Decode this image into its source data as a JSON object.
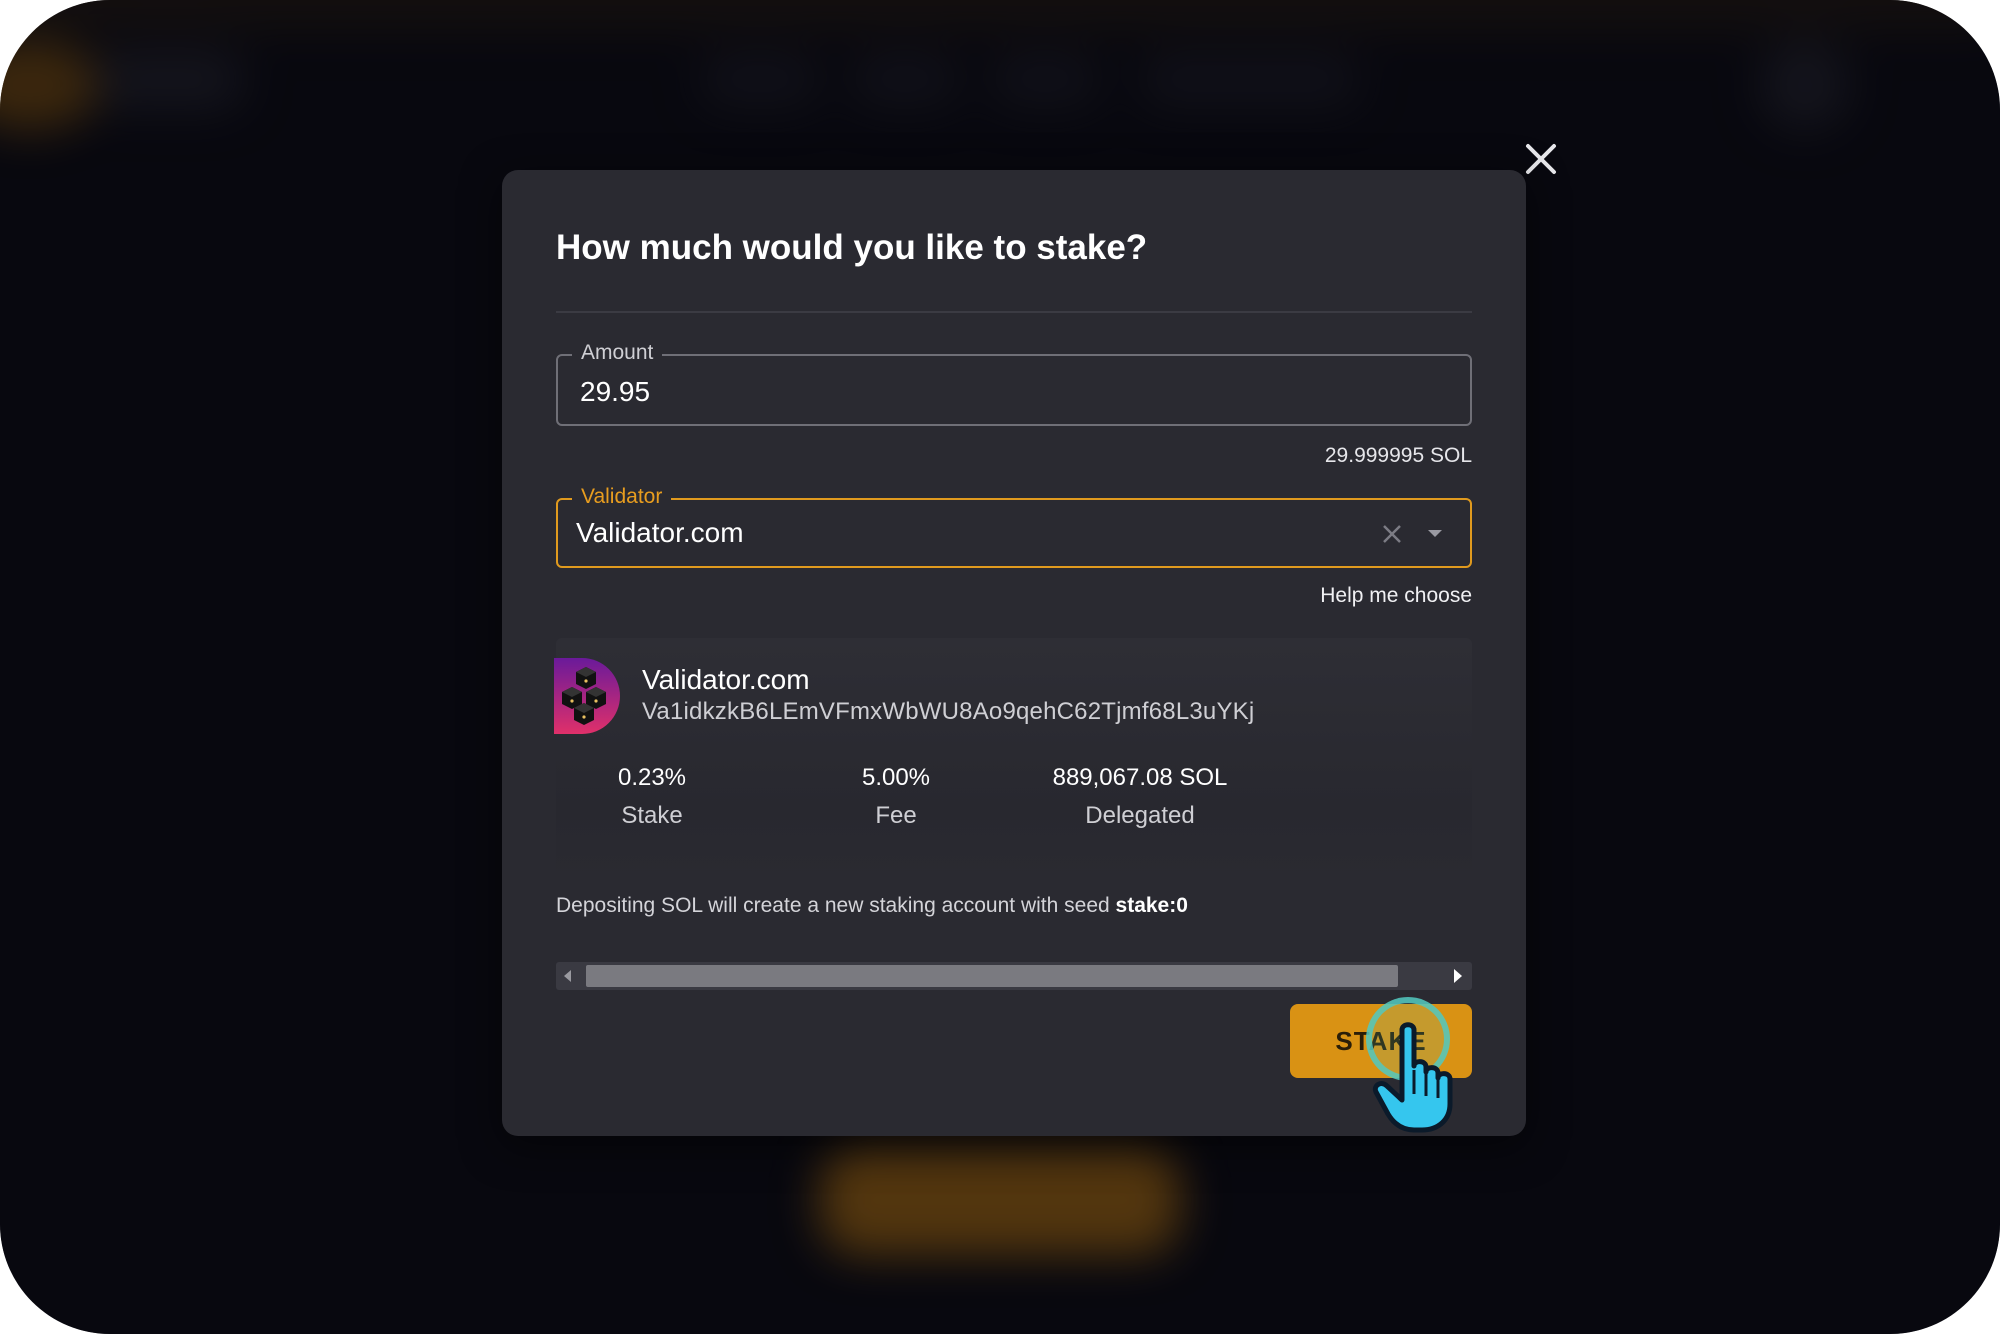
{
  "dialog": {
    "title": "How much would you like to stake?",
    "close_icon": "close-icon"
  },
  "amount": {
    "label": "Amount",
    "value": "29.95",
    "balance": "29.999995 SOL"
  },
  "validator_select": {
    "label": "Validator",
    "value": "Validator.com",
    "clear_icon": "close-icon",
    "dropdown_icon": "caret-down-icon"
  },
  "help_link": "Help me choose",
  "validator_card": {
    "name": "Validator.com",
    "address": "Va1idkzkB6LEmVFmxWbWU8Ao9qehC62Tjmf68L3uYKj",
    "stats": [
      {
        "value": "0.23%",
        "label": "Stake"
      },
      {
        "value": "5.00%",
        "label": "Fee"
      },
      {
        "value": "889,067.08 SOL",
        "label": "Delegated"
      }
    ]
  },
  "deposit_note": {
    "text": "Depositing SOL will create a new staking account with seed ",
    "seed": "stake:0"
  },
  "stake_button": "STAKE",
  "colors": {
    "accent": "#d99214",
    "modal_bg": "#2a2a31",
    "validator_border": "#e09a1e",
    "click_ring": "#54c8be"
  }
}
